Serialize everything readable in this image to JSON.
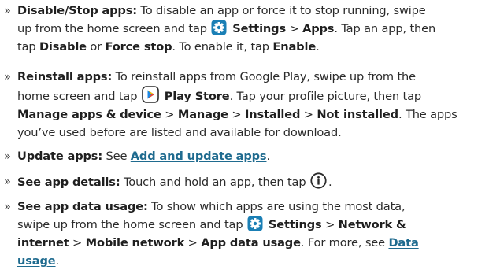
{
  "bullet_glyph": "»",
  "items": [
    {
      "lines": [
        [
          {
            "t": "b",
            "v": "Disable/Stop apps:"
          },
          {
            "t": "s",
            "v": " To disable an app or force it to stop running, swipe"
          }
        ],
        [
          {
            "t": "s",
            "v": "up from the home screen and tap "
          },
          {
            "t": "icon",
            "v": "settings-icon"
          },
          {
            "t": "b",
            "v": " Settings"
          },
          {
            "t": "s",
            "v": " > "
          },
          {
            "t": "b",
            "v": "Apps"
          },
          {
            "t": "s",
            "v": ". Tap an app, then"
          }
        ],
        [
          {
            "t": "s",
            "v": "tap "
          },
          {
            "t": "b",
            "v": "Disable"
          },
          {
            "t": "s",
            "v": " or "
          },
          {
            "t": "b",
            "v": "Force stop"
          },
          {
            "t": "s",
            "v": ". To enable it, tap "
          },
          {
            "t": "b",
            "v": "Enable"
          },
          {
            "t": "s",
            "v": "."
          }
        ]
      ]
    },
    {
      "lines": [
        [
          {
            "t": "b",
            "v": "Reinstall apps:"
          },
          {
            "t": "s",
            "v": " To reinstall apps from Google Play, swipe up from the"
          }
        ],
        [
          {
            "t": "s",
            "v": "home screen and tap "
          },
          {
            "t": "icon",
            "v": "play-store-icon"
          },
          {
            "t": "b",
            "v": " Play Store"
          },
          {
            "t": "s",
            "v": ". Tap your profile picture, then tap"
          }
        ],
        [
          {
            "t": "b",
            "v": "Manage apps & device"
          },
          {
            "t": "s",
            "v": " > "
          },
          {
            "t": "b",
            "v": "Manage"
          },
          {
            "t": "s",
            "v": " > "
          },
          {
            "t": "b",
            "v": "Installed"
          },
          {
            "t": "s",
            "v": " > "
          },
          {
            "t": "b",
            "v": "Not installed"
          },
          {
            "t": "s",
            "v": ". The apps"
          }
        ],
        [
          {
            "t": "s",
            "v": "you’ve used before are listed and available for download."
          }
        ]
      ]
    },
    {
      "lines": [
        [
          {
            "t": "b",
            "v": "Update apps:"
          },
          {
            "t": "s",
            "v": " See "
          },
          {
            "t": "link",
            "v": "Add and update apps"
          },
          {
            "t": "s",
            "v": "."
          }
        ]
      ]
    },
    {
      "lines": [
        [
          {
            "t": "b",
            "v": "See app details:"
          },
          {
            "t": "s",
            "v": " Touch and hold an app, then tap "
          },
          {
            "t": "icon",
            "v": "info-icon"
          },
          {
            "t": "s",
            "v": "."
          }
        ]
      ]
    },
    {
      "lines": [
        [
          {
            "t": "b",
            "v": "See app data usage:"
          },
          {
            "t": "s",
            "v": " To show which apps are using the most data,"
          }
        ],
        [
          {
            "t": "s",
            "v": "swipe up from the home screen and tap "
          },
          {
            "t": "icon",
            "v": "settings-icon"
          },
          {
            "t": "b",
            "v": " Settings"
          },
          {
            "t": "s",
            "v": " > "
          },
          {
            "t": "b",
            "v": "Network &"
          }
        ],
        [
          {
            "t": "b",
            "v": "internet"
          },
          {
            "t": "s",
            "v": " > "
          },
          {
            "t": "b",
            "v": "Mobile network"
          },
          {
            "t": "s",
            "v": " > "
          },
          {
            "t": "b",
            "v": "App data usage"
          },
          {
            "t": "s",
            "v": ". For more, see "
          },
          {
            "t": "link",
            "v": "Data"
          }
        ],
        [
          {
            "t": "link",
            "v": "usage"
          },
          {
            "t": "s",
            "v": "."
          }
        ]
      ]
    }
  ],
  "colors": {
    "text": "#2b2b2b",
    "bold": "#1f1f1f",
    "link": "#1f6b8f",
    "settings_icon": "#1a7fb5"
  }
}
